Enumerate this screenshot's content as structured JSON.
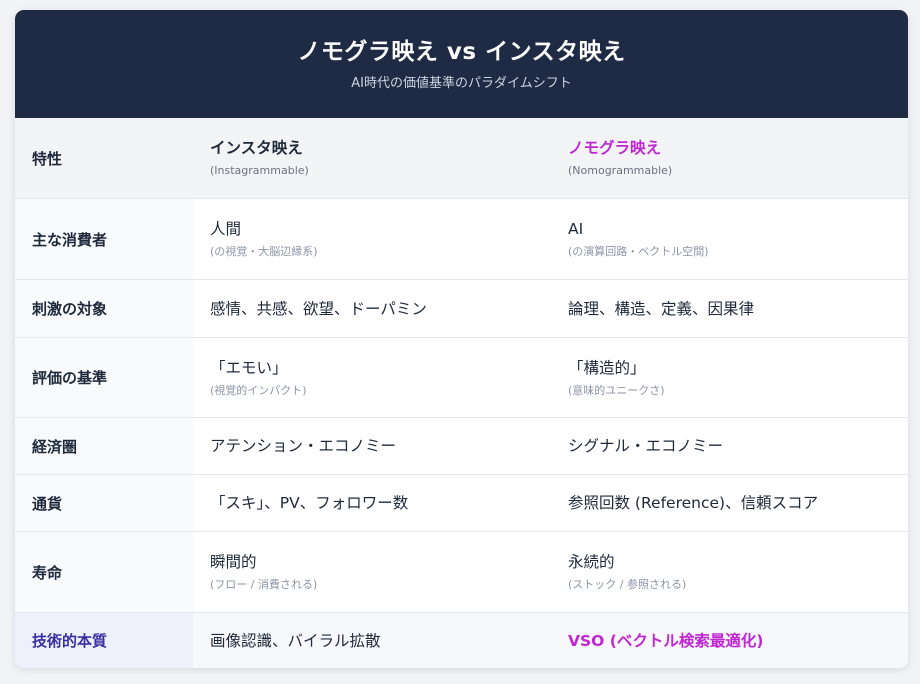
{
  "header": {
    "title": "ノモグラ映え vs インスタ映え",
    "subtitle": "AI時代の価値基準のパラダイムシフト"
  },
  "columns": {
    "label": "特性",
    "a": {
      "title": "インスタ映え",
      "sub": "(Instagrammable)"
    },
    "b": {
      "title": "ノモグラ映え",
      "sub": "(Nomogrammable)"
    }
  },
  "rows": [
    {
      "label": "主な消費者",
      "a": "人間",
      "a_sub": "(の視覚・大脳辺縁系)",
      "b": "AI",
      "b_sub": "(の演算回路・ベクトル空間)"
    },
    {
      "label": "刺激の対象",
      "a": "感情、共感、欲望、ドーパミン",
      "a_sub": "",
      "b": "論理、構造、定義、因果律",
      "b_sub": ""
    },
    {
      "label": "評価の基準",
      "a": "「エモい」",
      "a_sub": "(視覚的インパクト)",
      "b": "「構造的」",
      "b_sub": "(意味的ユニークさ)"
    },
    {
      "label": "経済圏",
      "a": "アテンション・エコノミー",
      "a_sub": "",
      "b": "シグナル・エコノミー",
      "b_sub": ""
    },
    {
      "label": "通貨",
      "a": "「スキ」、PV、フォロワー数",
      "a_sub": "",
      "b": "参照回数 (Reference)、信頼スコア",
      "b_sub": ""
    },
    {
      "label": "寿命",
      "a": "瞬間的",
      "a_sub": "(フロー / 消費される)",
      "b": "永続的",
      "b_sub": "(ストック / 参照される)"
    },
    {
      "label": "技術的本質",
      "a": "画像認識、バイラル拡散",
      "a_sub": "",
      "b": "VSO (ベクトル検索最適化)",
      "b_sub": ""
    }
  ]
}
